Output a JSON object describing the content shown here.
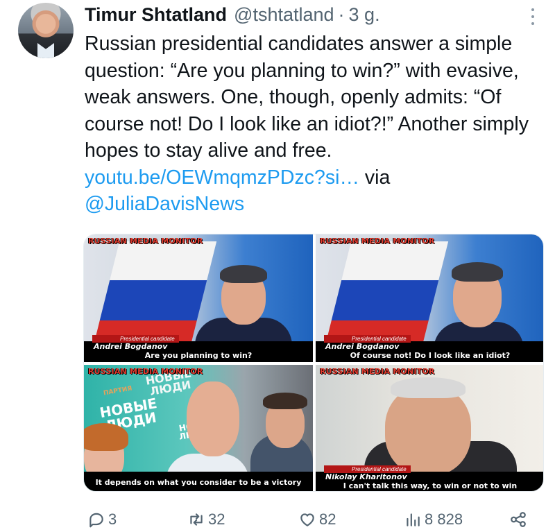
{
  "tweet": {
    "author_name": "Timur Shtatland",
    "handle": "@tshtatland",
    "separator": "·",
    "time": "3 g.",
    "text_main": "Russian presidential candidates answer a simple question: “Are you planning to win?” with evasive, weak answers. One, though, openly admits: “Of course not! Do I look like an idiot?!” Another simply hopes to stay alive and free. ",
    "link_text": "youtu.be/OEWmqmzPDzc?si…",
    "text_via": " via ",
    "mention": "@JuliaDavisNews"
  },
  "media": {
    "watermark": "RUSSIAN MEDIA MONITOR",
    "tiles": [
      {
        "label": "Presidential candidate",
        "name": "Andrei Bogdanov",
        "subtitle": "Are you planning to win?"
      },
      {
        "label": "Presidential candidate",
        "name": "Andrei Bogdanov",
        "subtitle": "Of course not! Do I look like an idiot?"
      },
      {
        "sign_top": "НОВЫЕ\nЛЮДИ",
        "sign_party": "ПАРТИЯ",
        "sign_left": "НОВЫЕ\nЛЮДИ",
        "sign_right": "НО\nЛЮ",
        "subtitle": "It depends on what you consider to be a victory"
      },
      {
        "label": "Presidential candidate",
        "name": "Nikolay Kharitonov",
        "subtitle": "I can't talk this way, to win or not to win"
      }
    ]
  },
  "actions": {
    "replies": "3",
    "reposts": "32",
    "likes": "82",
    "views": "8 828"
  },
  "icons": [
    "more-icon",
    "reply-icon",
    "repost-icon",
    "like-icon",
    "views-icon",
    "share-icon"
  ]
}
